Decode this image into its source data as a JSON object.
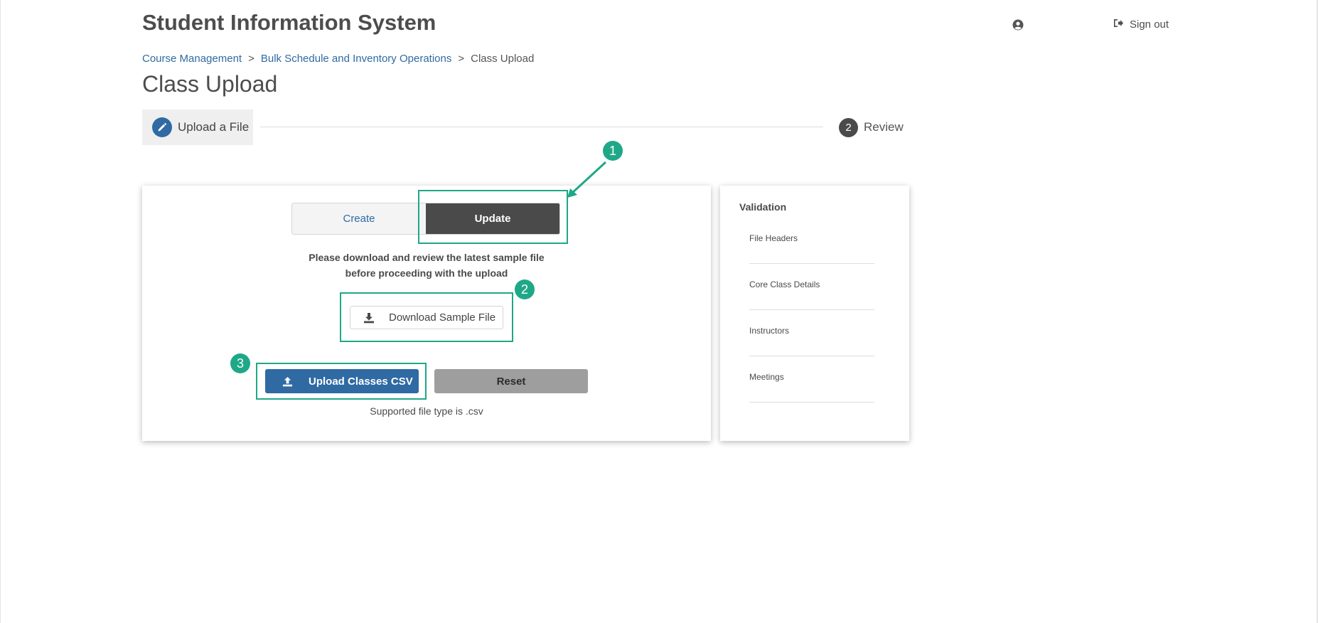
{
  "header": {
    "app_title": "Student Information System",
    "sign_out_label": "Sign out"
  },
  "breadcrumb": {
    "items": [
      "Course Management",
      "Bulk Schedule and Inventory Operations",
      "Class Upload"
    ],
    "separator": ">"
  },
  "page_title": "Class Upload",
  "stepper": {
    "steps": [
      {
        "label": "Upload a File",
        "icon": "pencil-icon",
        "state": "active"
      },
      {
        "number": "2",
        "label": "Review",
        "state": "pending"
      }
    ]
  },
  "upload_form": {
    "mode_toggle": {
      "options": [
        "Create",
        "Update"
      ],
      "selected": "Update"
    },
    "instructions_line1": "Please download and review the latest sample file",
    "instructions_line2": "before proceeding with the upload",
    "download_sample_label": "Download Sample File",
    "upload_label": "Upload Classes CSV",
    "reset_label": "Reset",
    "supported_note": "Supported file type is .csv"
  },
  "validation": {
    "title": "Validation",
    "items": [
      "File Headers",
      "Core Class Details",
      "Instructors",
      "Meetings"
    ]
  },
  "annotations": {
    "badges": [
      "1",
      "2",
      "3"
    ]
  },
  "colors": {
    "accent_blue": "#2f6aa3",
    "annotation_green": "#1fa887",
    "dark_toggle": "#4a4a4a",
    "reset_gray": "#9e9e9e"
  }
}
